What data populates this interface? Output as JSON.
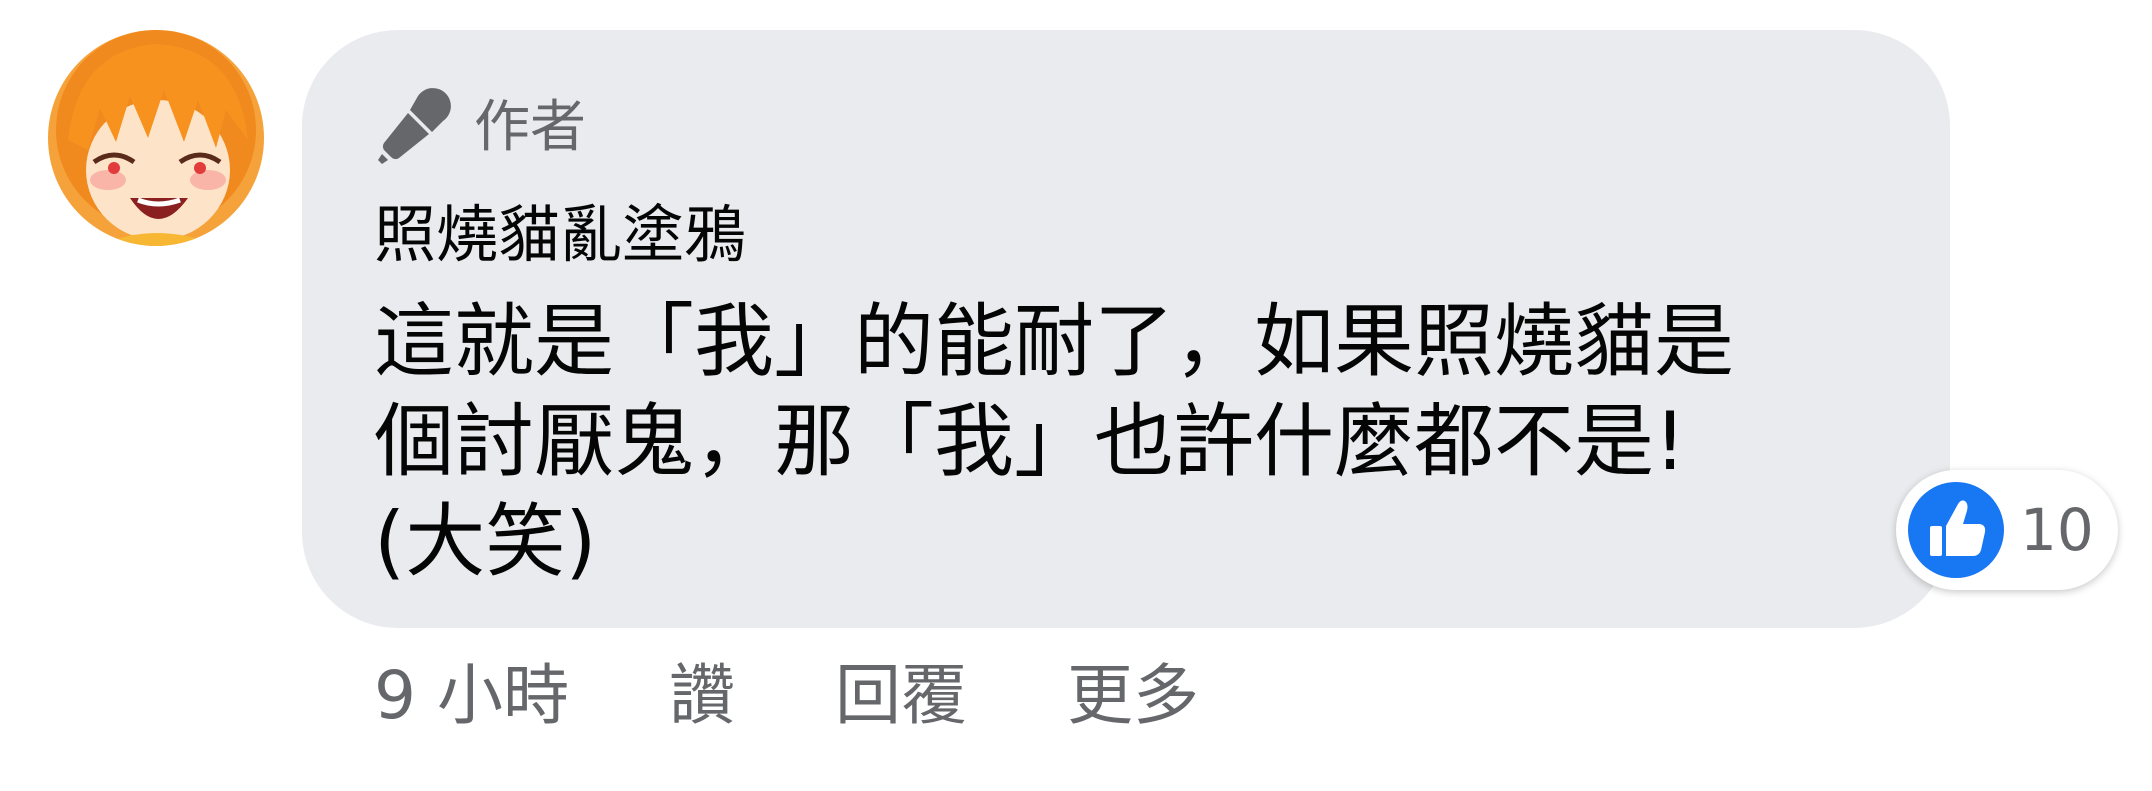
{
  "comment": {
    "avatar_icon": "anime-avatar-orange-hair",
    "author_badge": {
      "icon": "microphone-icon",
      "label": "作者"
    },
    "commenter_name": "照燒貓亂塗鴉",
    "text_lines": [
      "這就是「我」的能耐了，如果照燒貓是",
      "個討厭鬼，那「我」也許什麼都不是!",
      "(大笑)"
    ],
    "reactions": {
      "icon": "thumbs-up-icon",
      "count": "10",
      "color": "#1877f2"
    },
    "actions": {
      "timestamp": "9 小時",
      "like_label": "讚",
      "reply_label": "回覆",
      "more_label": "更多"
    }
  },
  "colors": {
    "bubble_bg": "#eaebee",
    "secondary_text": "#65676b",
    "primary_text": "#050505",
    "like_blue": "#1877f2"
  }
}
